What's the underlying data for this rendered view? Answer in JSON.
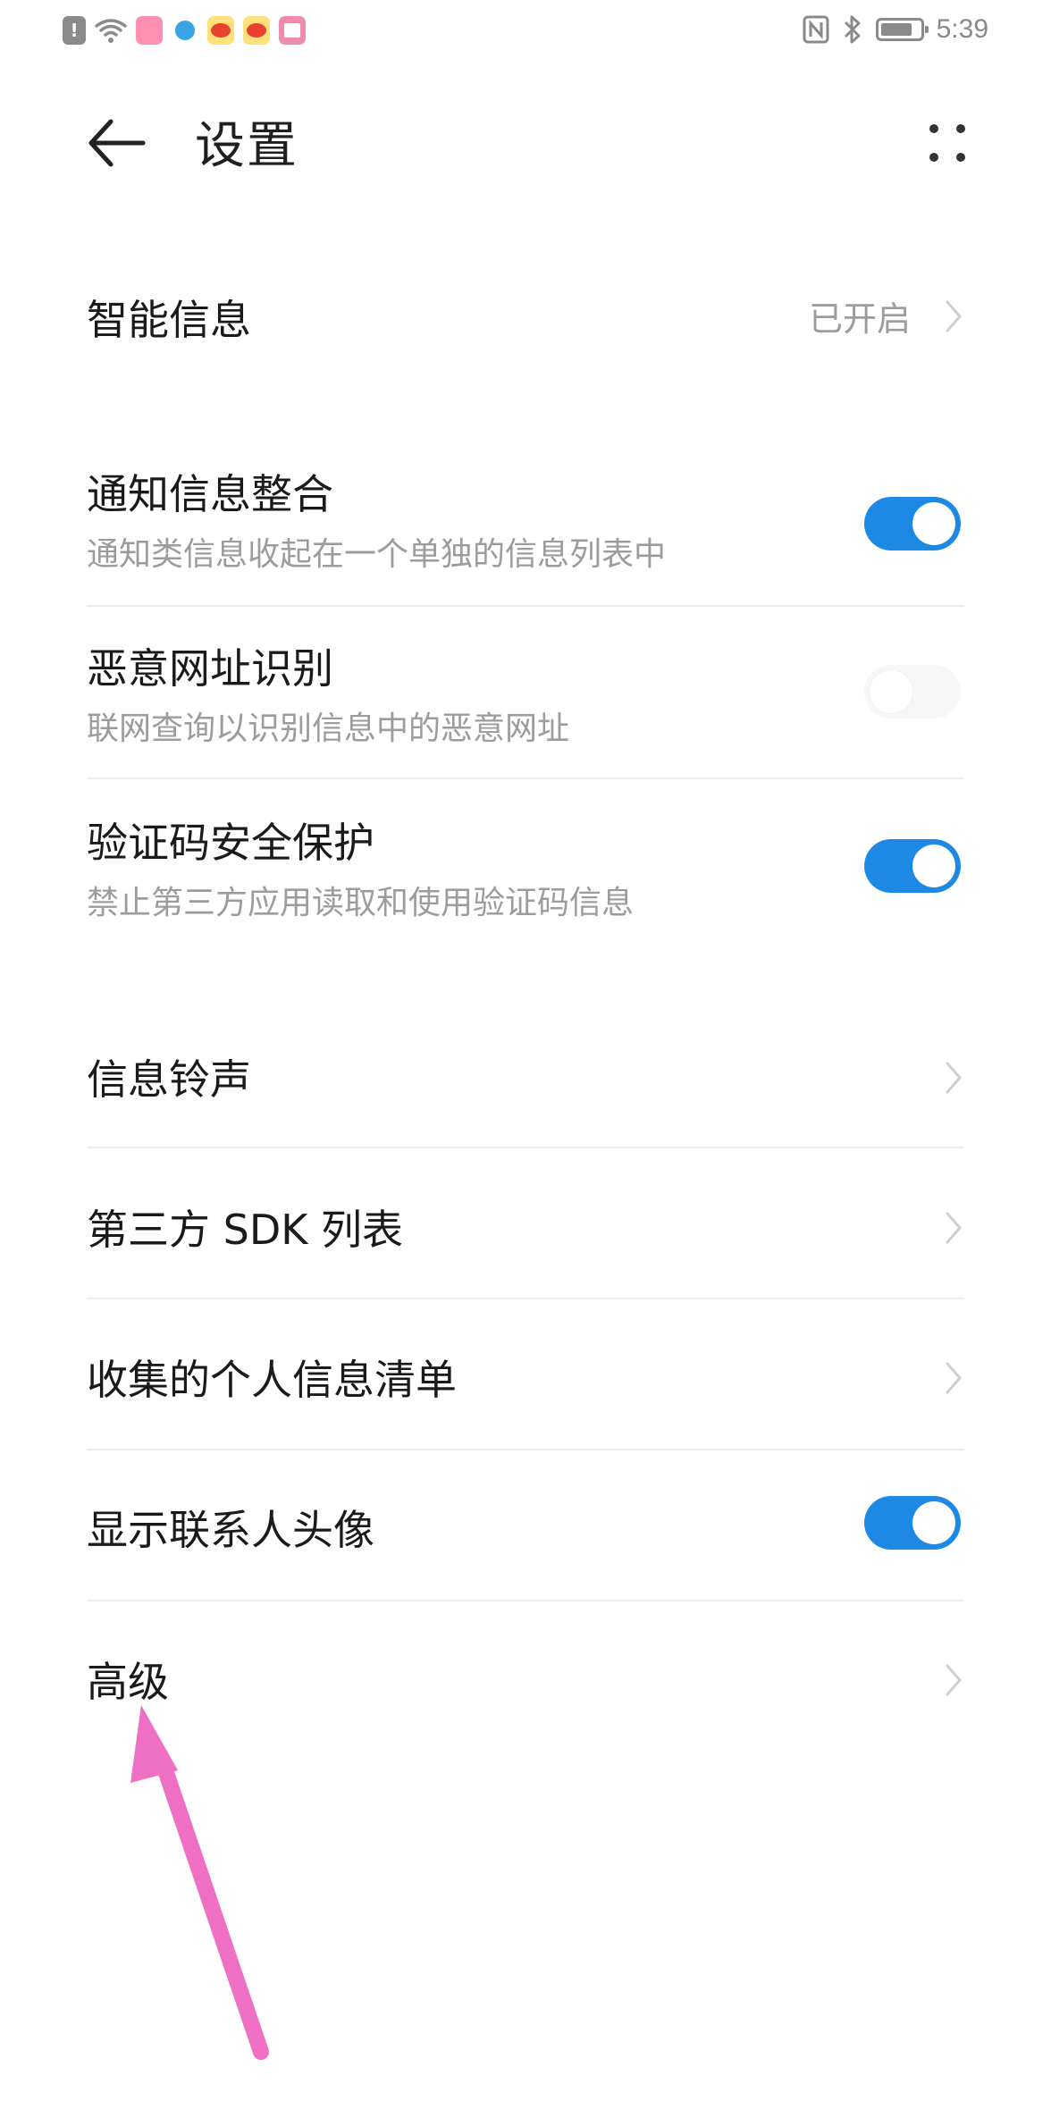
{
  "status_bar": {
    "time": "5:39",
    "icons": [
      "alert-icon",
      "wifi-icon",
      "huawei-app-icon",
      "telegram-app-icon",
      "weibo-app-icon",
      "weibo-app-icon",
      "book-app-icon",
      "nfc-icon",
      "bluetooth-icon",
      "battery-icon"
    ]
  },
  "header": {
    "title": "设置",
    "back_icon": "back-arrow-icon",
    "more_icon": "more-options-icon"
  },
  "settings": {
    "smart_info": {
      "label": "智能信息",
      "value": "已开启"
    },
    "notification_merge": {
      "label": "通知信息整合",
      "desc": "通知类信息收起在一个单独的信息列表中",
      "enabled": true
    },
    "malicious_url": {
      "label": "恶意网址识别",
      "desc": "联网查询以识别信息中的恶意网址",
      "enabled": false
    },
    "verification_code": {
      "label": "验证码安全保护",
      "desc": "禁止第三方应用读取和使用验证码信息",
      "enabled": true
    },
    "ringtone": {
      "label": "信息铃声"
    },
    "third_party_sdk": {
      "label": "第三方 SDK 列表"
    },
    "personal_info_list": {
      "label": "收集的个人信息清单"
    },
    "contact_avatar": {
      "label": "显示联系人头像",
      "enabled": true
    },
    "advanced": {
      "label": "高级"
    }
  },
  "colors": {
    "accent": "#1e88e5",
    "annotation_arrow": "#ee6fc3"
  }
}
